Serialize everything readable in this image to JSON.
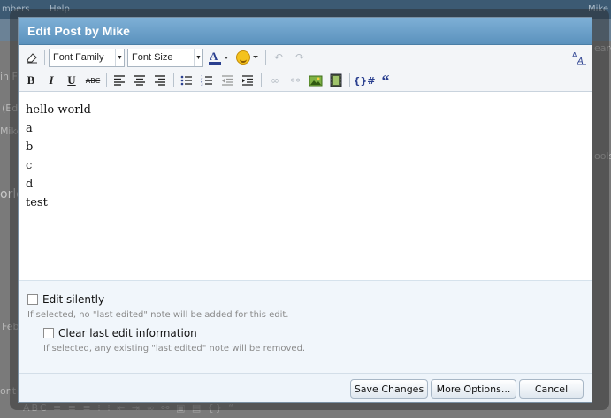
{
  "background": {
    "topbar_items": [
      "mbers",
      "Help",
      "Mike"
    ],
    "side_texts": [
      "in F",
      "(Ed",
      "Mike",
      "orld",
      "Feb",
      "ont F",
      "ools",
      "earch"
    ]
  },
  "dialog": {
    "title": "Edit Post by Mike"
  },
  "toolbar": {
    "font_family": "Font Family",
    "font_size": "Font Size",
    "bold": "B",
    "italic": "I",
    "underline": "U",
    "strike": "ABC",
    "code_tag": "{}#",
    "quote": "“"
  },
  "editor": {
    "lines": [
      "hello world",
      "a",
      "b",
      "c",
      "d",
      "test"
    ]
  },
  "options": {
    "edit_silently_label": "Edit silently",
    "edit_silently_hint": "If selected, no \"last edited\" note will be added for this edit.",
    "edit_silently_checked": false,
    "clear_edit_label": "Clear last edit information",
    "clear_edit_hint": "If selected, any existing \"last edited\" note will be removed.",
    "clear_edit_checked": false
  },
  "buttons": {
    "save": "Save Changes",
    "more": "More Options...",
    "cancel": "Cancel"
  },
  "colors": {
    "title_bar": "#6aa0c9",
    "options_bg": "#f1f6fb"
  }
}
